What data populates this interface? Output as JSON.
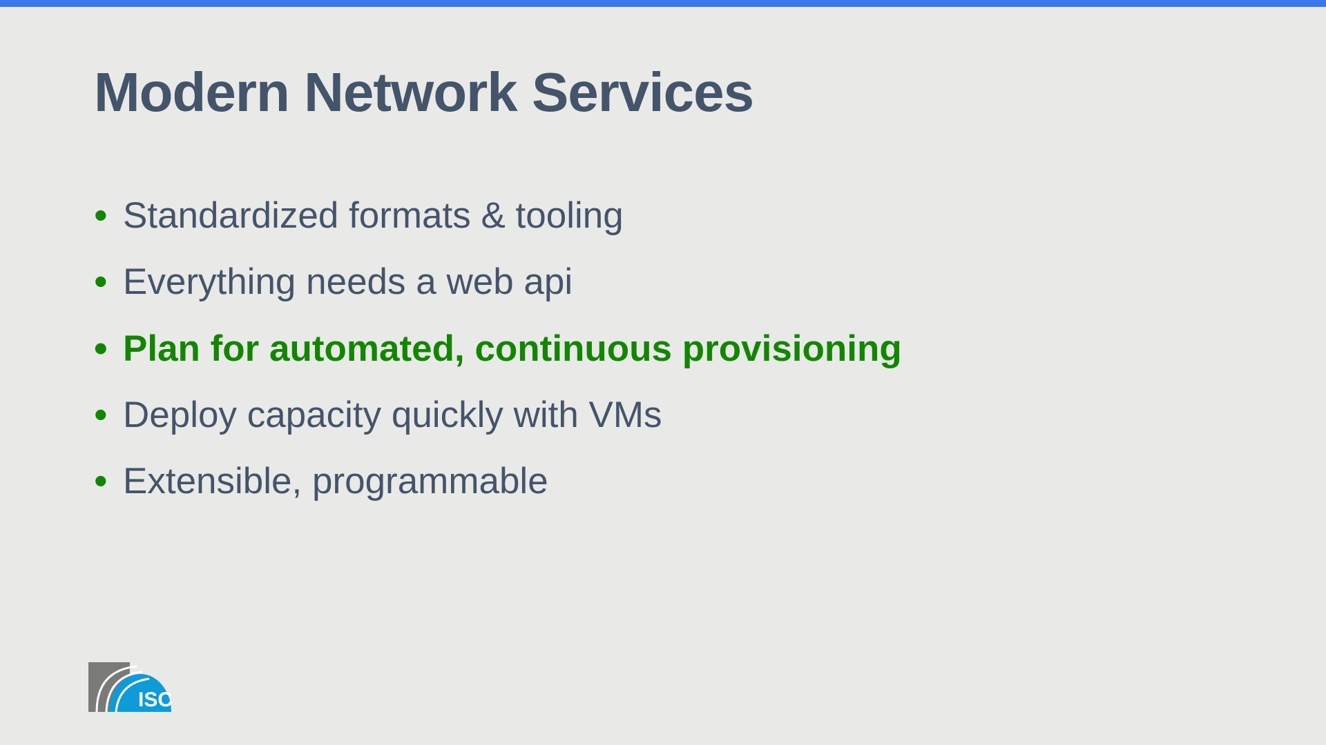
{
  "slide": {
    "title": "Modern Network Services",
    "bullets": [
      {
        "text": "Standardized formats & tooling",
        "highlight": false
      },
      {
        "text": "Everything needs a web api",
        "highlight": false
      },
      {
        "text": "Plan for automated, continuous provisioning",
        "highlight": true
      },
      {
        "text": "Deploy capacity quickly with VMs",
        "highlight": false
      },
      {
        "text": "Extensible, programmable",
        "highlight": false
      }
    ],
    "logo_text": "ISC",
    "colors": {
      "accent_bar": "#3a77ea",
      "title": "#44546a",
      "body": "#44546a",
      "bullet_marker": "#128600",
      "highlight": "#128600",
      "logo_blue": "#0e9bd8",
      "logo_gray": "#7a7a78",
      "background": "#e9e9e8"
    }
  }
}
